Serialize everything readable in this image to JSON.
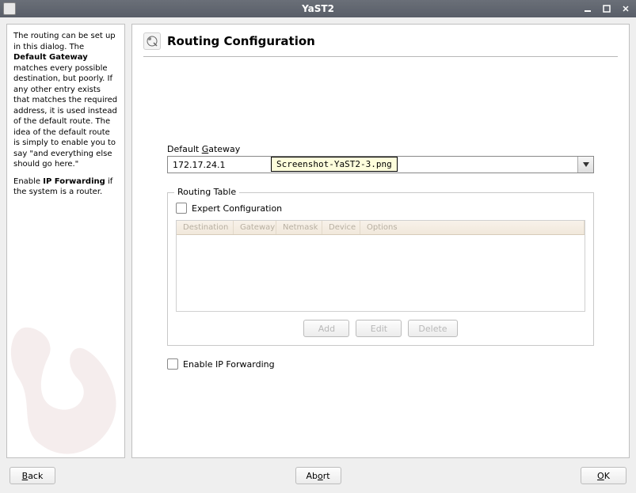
{
  "window": {
    "title": "YaST2"
  },
  "help": {
    "p1_prefix": "The routing can be set up in this dialog. The ",
    "p1_bold": "Default Gateway",
    "p1_suffix": " matches every possible destination, but poorly. If any other entry exists that matches the required address, it is used instead of the default route. The idea of the default route is simply to enable you to say \"and everything else should go here.\"",
    "p2_prefix": "Enable ",
    "p2_bold": "IP Forwarding",
    "p2_suffix": " if the system is a router."
  },
  "heading": "Routing Configuration",
  "gateway": {
    "label_pre": "Default ",
    "label_ul": "G",
    "label_post": "ateway",
    "value": "172.17.24.1"
  },
  "tooltip": "Screenshot-YaST2-3.png",
  "routing_table": {
    "legend": "Routing Table",
    "expert_pre": "E",
    "expert_post": "xpert Configuration",
    "columns": {
      "destination": "Destination",
      "gateway": "Gateway",
      "netmask": "Netmask",
      "device": "Device",
      "options": "Options"
    },
    "buttons": {
      "add": "Add",
      "edit": "Edit",
      "delete": "Delete"
    }
  },
  "ip_forwarding": {
    "pre": "Enable ",
    "ul": "I",
    "post": "P Forwarding"
  },
  "footer": {
    "back_ul": "B",
    "back_post": "ack",
    "abort_pre": "Ab",
    "abort_ul": "o",
    "abort_post": "rt",
    "ok_ul": "O",
    "ok_post": "K"
  }
}
